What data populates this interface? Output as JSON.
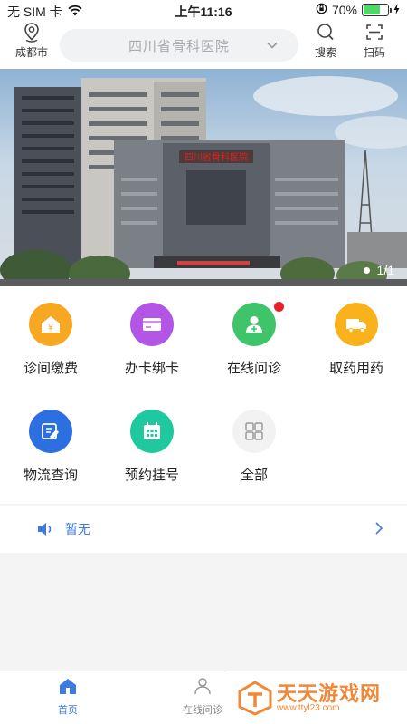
{
  "status": {
    "carrier": "无 SIM 卡",
    "time": "上午11:16",
    "battery": "70%",
    "battery_level": 0.7
  },
  "header": {
    "location_label": "成都市",
    "hospital": "四川省骨科医院",
    "search_label": "搜索",
    "scan_label": "扫码"
  },
  "banner": {
    "building_sign": "四川省骨科医院",
    "page_indicator": "1/1"
  },
  "services": [
    {
      "label": "诊间缴费",
      "icon": "clinic-payment-icon",
      "color": "#f7a823"
    },
    {
      "label": "办卡绑卡",
      "icon": "card-icon",
      "color": "#b356e6"
    },
    {
      "label": "在线问诊",
      "icon": "doctor-icon",
      "color": "#3fc46a",
      "badge": true
    },
    {
      "label": "取药用药",
      "icon": "delivery-truck-icon",
      "color": "#f9b21c"
    },
    {
      "label": "物流查询",
      "icon": "logistics-icon",
      "color": "#2b6fe0"
    },
    {
      "label": "预约挂号",
      "icon": "calendar-icon",
      "color": "#1fc89e"
    },
    {
      "label": "全部",
      "icon": "grid-icon",
      "color": "#f2f2f2"
    }
  ],
  "notice": {
    "text": "暂无"
  },
  "tabbar": {
    "home_label": "首页",
    "consult_label": "在线问诊",
    "active_color": "#3d7be0"
  },
  "watermark": {
    "title": "天天游戏网",
    "url": "www.ttyl23.com"
  }
}
